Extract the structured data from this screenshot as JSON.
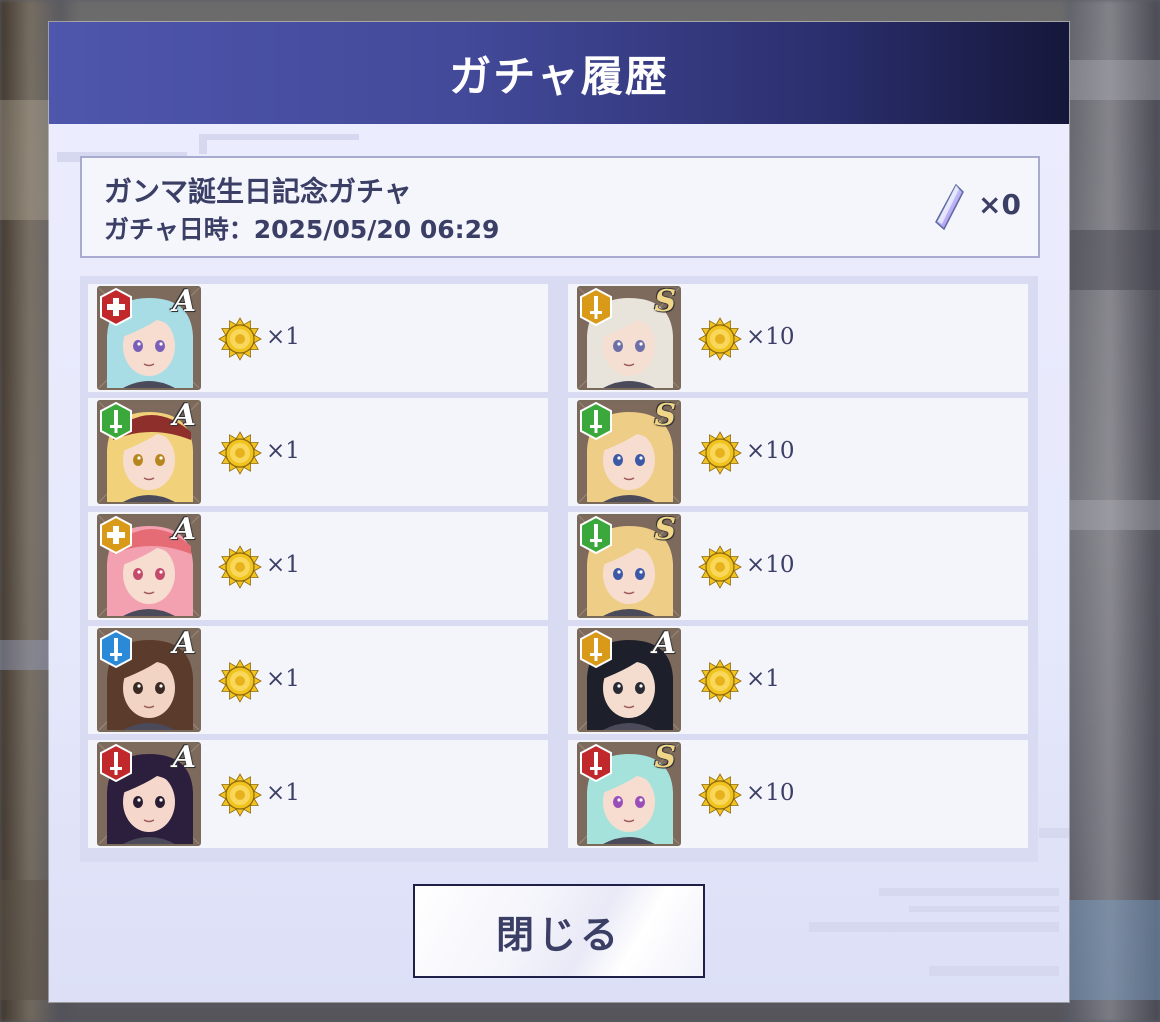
{
  "dialog": {
    "title": "ガチャ履歴",
    "gacha_name": "ガンマ誕生日記念ガチャ",
    "gacha_date": "ガチャ日時：2025/05/20 06:29",
    "cost_icon": "crystal-icon",
    "cost_value": "×0",
    "close_label": "閉じる"
  },
  "results": [
    {
      "rank": "A",
      "attribute": "red-cross",
      "qty": "×1",
      "hair": "#a9dde6",
      "skin": "#f7ddd0",
      "eyes": "#7a5fb8",
      "hat": ""
    },
    {
      "rank": "S",
      "attribute": "yellow-sword",
      "qty": "×10",
      "hair": "#e8e4dc",
      "skin": "#f5ded2",
      "eyes": "#6d6fa8",
      "hat": ""
    },
    {
      "rank": "A",
      "attribute": "green-sword",
      "qty": "×1",
      "hair": "#f1d27a",
      "skin": "#f7ddd0",
      "eyes": "#b8861f",
      "hat": "#8e2f2b"
    },
    {
      "rank": "S",
      "attribute": "green-sword",
      "qty": "×10",
      "hair": "#eecd86",
      "skin": "#f7ddd0",
      "eyes": "#3c59a8",
      "hat": ""
    },
    {
      "rank": "A",
      "attribute": "yellow-cross",
      "qty": "×1",
      "hair": "#f3a1b1",
      "skin": "#f7ddd0",
      "eyes": "#c44a6b",
      "hat": "#e56b74"
    },
    {
      "rank": "S",
      "attribute": "green-sword",
      "qty": "×10",
      "hair": "#eecd86",
      "skin": "#f7ddd0",
      "eyes": "#3c59a8",
      "hat": ""
    },
    {
      "rank": "A",
      "attribute": "blue-sword",
      "qty": "×1",
      "hair": "#5b3b2c",
      "skin": "#f1d4c4",
      "eyes": "#3b2a22",
      "hat": ""
    },
    {
      "rank": "A",
      "attribute": "yellow-sword",
      "qty": "×1",
      "hair": "#1d1f2a",
      "skin": "#f4dccf",
      "eyes": "#2a2a35",
      "hat": ""
    },
    {
      "rank": "A",
      "attribute": "red-sword",
      "qty": "×1",
      "hair": "#2c1f3d",
      "skin": "#f6d7cc",
      "eyes": "#2a1d33",
      "hat": ""
    },
    {
      "rank": "S",
      "attribute": "red-sword",
      "qty": "×10",
      "hair": "#a6e2dc",
      "skin": "#f7ddd0",
      "eyes": "#9a4fb8",
      "hat": ""
    }
  ],
  "colors": {
    "header_start": "#4e56ad",
    "header_end": "#15173a",
    "text": "#3b3f66",
    "attr_red": "#c0282b",
    "attr_yellow": "#d99a1a",
    "attr_green": "#3aa83a",
    "attr_blue": "#2b8ad8",
    "coin": "#f2c21e"
  }
}
